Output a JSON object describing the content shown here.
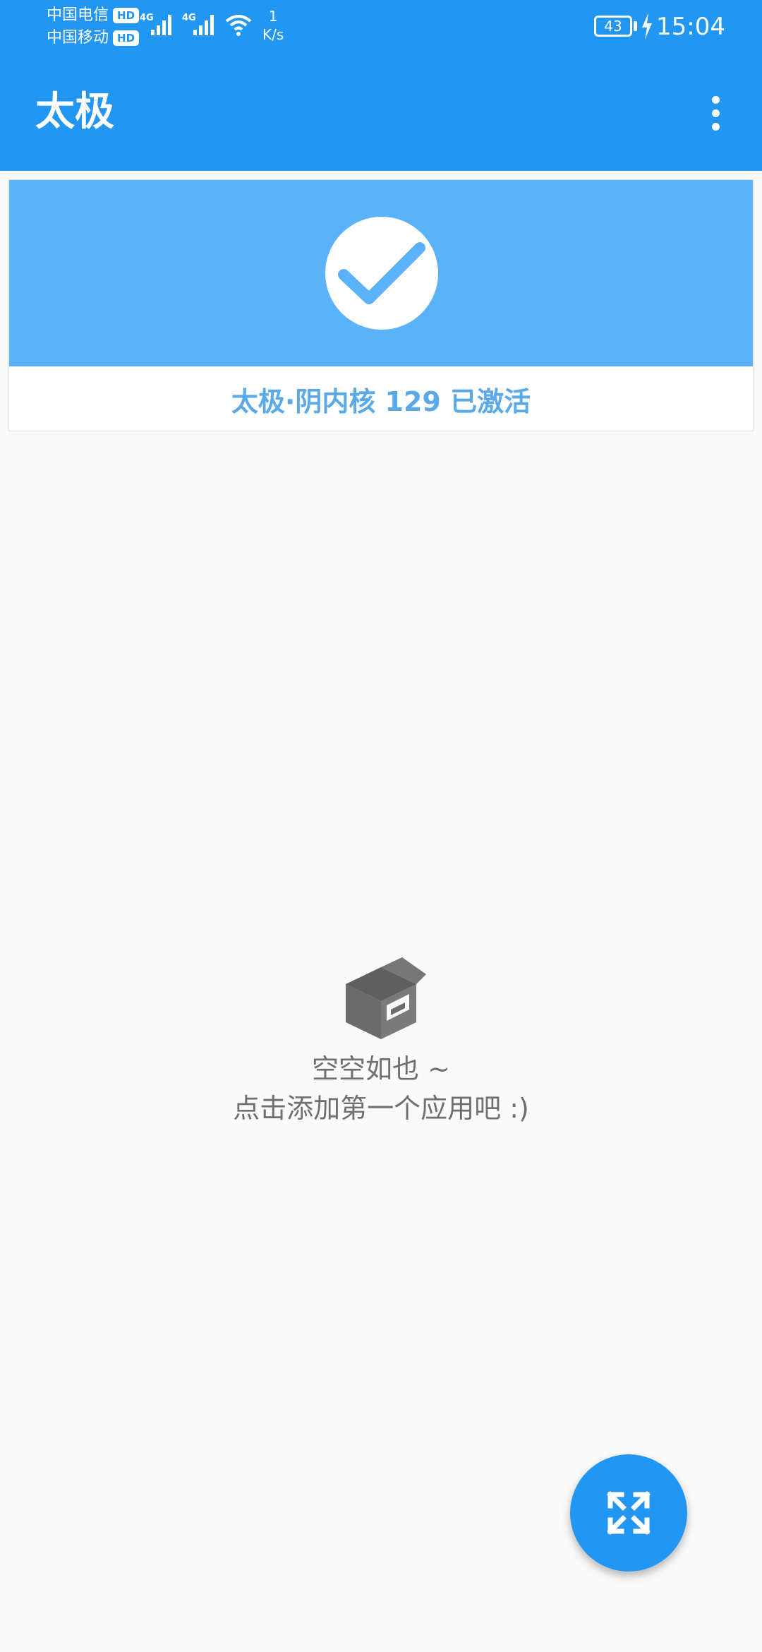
{
  "status_bar": {
    "carrier_1": "中国电信",
    "carrier_2": "中国移动",
    "hd_badge": "HD",
    "signal_1_label": "4G",
    "signal_2_label": "4G",
    "net_speed_value": "1",
    "net_speed_unit": "K/s",
    "battery_level": "43",
    "time": "15:04"
  },
  "app_bar": {
    "title": "太极",
    "overflow_icon": "more-vert-icon"
  },
  "status_card": {
    "icon": "check-icon",
    "status_text": "太极·阴内核 129 已激活",
    "banner_color": "#5bb2f8"
  },
  "empty_state": {
    "icon": "open-box-icon",
    "line1": "空空如也 ~",
    "line2": "点击添加第一个应用吧 :)"
  },
  "fab": {
    "icon": "expand-arrows-icon"
  },
  "colors": {
    "primary": "#2196f3",
    "status_text": "#5aa9e8",
    "empty_text": "#6f6f6f"
  }
}
